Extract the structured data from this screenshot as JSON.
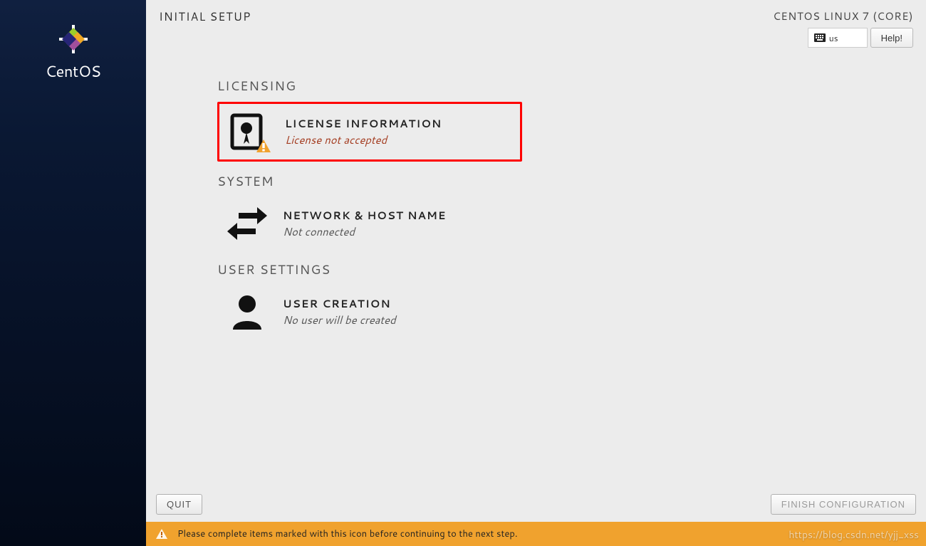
{
  "header": {
    "title": "INITIAL SETUP",
    "distro": "CENTOS LINUX 7 (CORE)",
    "lang": "us",
    "help_label": "Help!"
  },
  "sidebar": {
    "brand": "CentOS"
  },
  "sections": {
    "licensing": {
      "heading": "LICENSING",
      "spoke_title": "LICENSE INFORMATION",
      "spoke_status": "License not accepted"
    },
    "system": {
      "heading": "SYSTEM",
      "spoke_title": "NETWORK & HOST NAME",
      "spoke_status": "Not connected"
    },
    "user": {
      "heading": "USER SETTINGS",
      "spoke_title": "USER CREATION",
      "spoke_status": "No user will be created"
    }
  },
  "footer": {
    "quit": "QUIT",
    "finish": "FINISH CONFIGURATION"
  },
  "warning": {
    "text": "Please complete items marked with this icon before continuing to the next step."
  },
  "watermark": "https://blog.csdn.net/yjj_xss"
}
